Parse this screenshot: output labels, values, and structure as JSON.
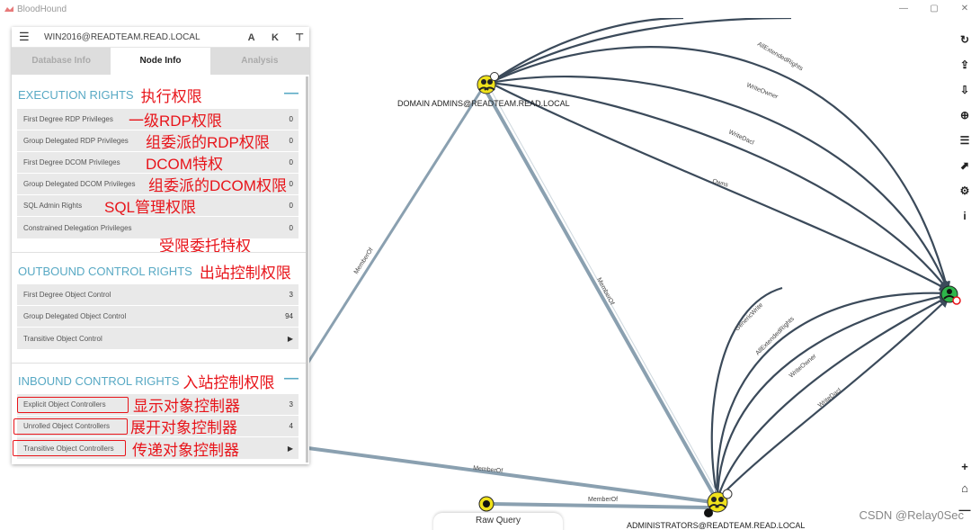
{
  "app": {
    "title": "BloodHound"
  },
  "window_controls": {
    "minimize": "—",
    "restore": "▢",
    "close": "✕"
  },
  "search": {
    "value": "WIN2016@READTEAM.READ.LOCAL"
  },
  "tabs": [
    {
      "label": "Database Info",
      "active": false
    },
    {
      "label": "Node Info",
      "active": true
    },
    {
      "label": "Analysis",
      "active": false
    }
  ],
  "sections": {
    "execution": {
      "title": "EXECUTION RIGHTS",
      "note": "执行权限",
      "collapse": "—",
      "rows": [
        {
          "label": "First Degree RDP Privileges",
          "value": "0",
          "note": "一级RDP权限"
        },
        {
          "label": "Group Delegated RDP Privileges",
          "value": "0",
          "note": "组委派的RDP权限"
        },
        {
          "label": "First Degree DCOM Privileges",
          "value": "0",
          "note": "DCOM特权"
        },
        {
          "label": "Group Delegated DCOM Privileges",
          "value": "0",
          "note": "组委派的DCOM权限"
        },
        {
          "label": "SQL Admin Rights",
          "value": "0",
          "note": "SQL管理权限"
        },
        {
          "label": "Constrained Delegation Privileges",
          "value": "0",
          "note": "受限委托特权"
        }
      ]
    },
    "outbound": {
      "title": "OUTBOUND CONTROL RIGHTS",
      "note": "出站控制权限",
      "rows": [
        {
          "label": "First Degree Object Control",
          "value": "3"
        },
        {
          "label": "Group Delegated Object Control",
          "value": "94"
        },
        {
          "label": "Transitive Object Control",
          "value": "▶"
        }
      ]
    },
    "inbound": {
      "title": "INBOUND CONTROL RIGHTS",
      "note": "入站控制权限",
      "collapse": "—",
      "rows": [
        {
          "label": "Explicit Object Controllers",
          "value": "3",
          "note": "显示对象控制器"
        },
        {
          "label": "Unrolled Object Controllers",
          "value": "4",
          "note": "展开对象控制器"
        },
        {
          "label": "Transitive Object Controllers",
          "value": "▶",
          "note": "传递对象控制器"
        }
      ]
    }
  },
  "graph": {
    "nodes": {
      "domain_admins": "DOMAIN ADMINS@READTEAM.READ.LOCAL",
      "administrators": "ADMINISTRATORS@READTEAM.READ.LOCAL"
    },
    "edge_labels": {
      "top_all_extended": "AllExtendedRights",
      "top_write_owner": "WriteOwner",
      "top_write_dacl": "WriteDacl",
      "top_owns": "Owns",
      "da_member_of_left": "MemberOf",
      "da_member_of_mid": "MemberOf",
      "bot_generic_write": "GenericWrite",
      "bot_all_extended": "AllExtendedRights",
      "bot_write_owner": "WriteOwner",
      "bot_write_dacl": "WriteDacl",
      "left_member_of": "MemberOf",
      "query_member_of": "MemberOf"
    }
  },
  "right_toolbar": [
    "↻",
    "⇪",
    "⇩",
    "⊕",
    "☰",
    "⬈",
    "⚙",
    "i"
  ],
  "zoom": {
    "in": "+",
    "home": "⌂",
    "out": "—"
  },
  "raw_query": {
    "label": "Raw Query"
  },
  "watermark": "CSDN @Relay0Sec",
  "colors": {
    "accent": "#58a9c4",
    "annotation": "#e8141a",
    "edge": "#3b4a5a",
    "node_user": "#f0e21b",
    "node_computer": "#2eb54a"
  }
}
